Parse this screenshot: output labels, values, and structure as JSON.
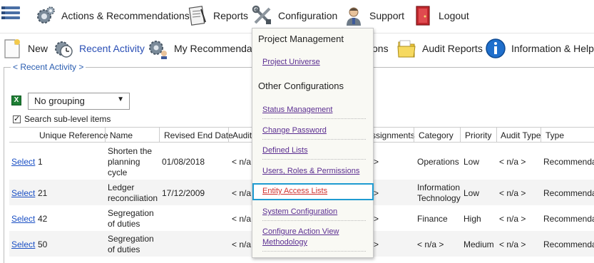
{
  "topnav": {
    "actions": "Actions & Recommendations",
    "reports": "Reports",
    "configuration": "Configuration",
    "support": "Support",
    "logout": "Logout"
  },
  "toolbar": {
    "new": "New",
    "recent": "Recent Activity",
    "my_recs": "My Recommendatio",
    "hidden_tail": "ons",
    "audit": "Audit Reports",
    "info": "Information & Help"
  },
  "activity": {
    "legend": "< Recent Activity >",
    "grouping": "No grouping",
    "search_sub": "Search sub-level items"
  },
  "table": {
    "headers": [
      "Unique Reference",
      "Name",
      "Revised End Date",
      "Audit",
      "ssignments",
      "Category",
      "Priority",
      "Audit Type",
      "Type"
    ],
    "rows": [
      {
        "select": "Select",
        "ref": "1",
        "name1": "Shorten the",
        "name2": "planning",
        "name3": "cycle",
        "date": "01/08/2018",
        "audit": "< n/a",
        "assign": ">",
        "cat1": "Operations",
        "cat2": "",
        "priority": "Low",
        "audit_type": "< n/a >",
        "type": "Recommendat"
      },
      {
        "select": "Select",
        "ref": "21",
        "name1": "Ledger",
        "name2": "reconciliation",
        "date": "17/12/2009",
        "audit": "< n/a",
        "assign": ">",
        "cat1": "Information",
        "cat2": "Technology",
        "priority": "Low",
        "audit_type": "< n/a >",
        "type": "Recommendat"
      },
      {
        "select": "Select",
        "ref": "42",
        "name1": "Segregation",
        "name2": "of duties",
        "date": "",
        "audit": "< n/a",
        "assign": ">",
        "cat1": "Finance",
        "cat2": "",
        "priority": "High",
        "audit_type": "< n/a >",
        "type": "Recommendat"
      },
      {
        "select": "Select",
        "ref": "50",
        "name1": "Segregation",
        "name2": "of duties",
        "date": "",
        "audit": "< n/a",
        "assign": ">",
        "cat1": "< n/a >",
        "cat2": "",
        "priority": "Medium",
        "audit_type": "< n/a >",
        "type": "Recommendat"
      }
    ]
  },
  "menu": {
    "group1": "Project Management",
    "project_universe": "Project Universe",
    "group2": "Other Configurations",
    "status": "Status Management",
    "password": "Change Password",
    "lists": "Defined Lists",
    "users": "Users, Roles & Permissions",
    "entity": "Entity Access Lists",
    "system": "System Configuration",
    "action_view_1": "Configure Action View",
    "action_view_2": "Methodology"
  }
}
